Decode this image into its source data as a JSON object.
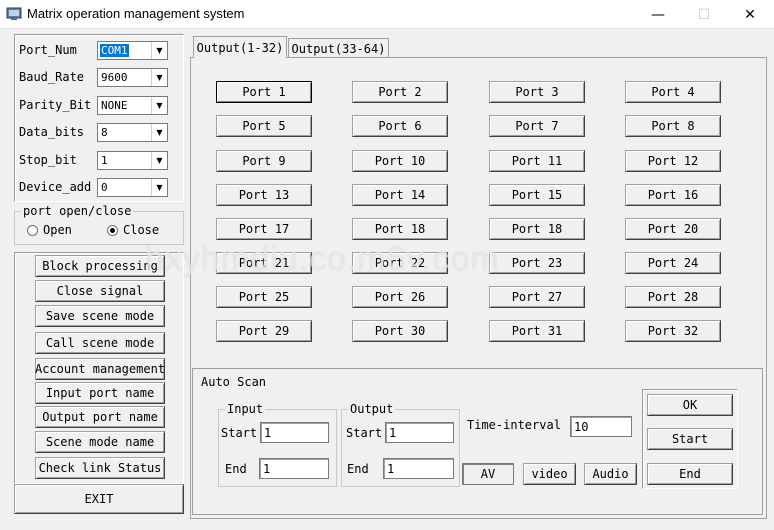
{
  "window": {
    "title": "Matrix operation management system",
    "minimize_glyph": "—",
    "maximize_glyph": "☐",
    "close_glyph": "✕"
  },
  "settings": [
    {
      "label": "Port_Num",
      "value": "COM1",
      "selected": true
    },
    {
      "label": "Baud_Rate",
      "value": "9600"
    },
    {
      "label": "Parity_Bit",
      "value": "NONE"
    },
    {
      "label": "Data_bits",
      "value": "8"
    },
    {
      "label": "Stop_bit",
      "value": "1"
    },
    {
      "label": "Device_add",
      "value": "0"
    }
  ],
  "port_toggle": {
    "title": "port open/close",
    "open_label": "Open",
    "close_label": "Close",
    "selected": "Close"
  },
  "actions": {
    "block_processing": "Block processing",
    "close_signal": "Close signal",
    "save_scene_mode": "Save scene mode",
    "call_scene_mode": "Call scene mode",
    "account_management": "Account management",
    "input_port_name": "Input port name",
    "output_port_name": "Output port name",
    "scene_mode_name": "Scene mode name",
    "check_link_status": "Check link Status",
    "exit": "EXIT"
  },
  "tabs": {
    "output_1_32": "Output(1-32)",
    "output_33_64": "Output(33-64)"
  },
  "ports": [
    "Port 1",
    "Port 2",
    "Port 3",
    "Port 4",
    "Port 5",
    "Port 6",
    "Port 7",
    "Port 8",
    "Port 9",
    "Port 10",
    "Port 11",
    "Port 12",
    "Port 13",
    "Port 14",
    "Port 15",
    "Port 16",
    "Port 17",
    "Port 18",
    "Port 18",
    "Port 20",
    "Port 21",
    "Port 22",
    "Port 23",
    "Port 24",
    "Port 25",
    "Port 26",
    "Port 27",
    "Port 28",
    "Port 29",
    "Port 30",
    "Port 31",
    "Port 32"
  ],
  "auto_scan": {
    "title": "Auto Scan",
    "input_title": "Input",
    "output_title": "Output",
    "start_label": "Start",
    "end_label": "End",
    "input_start": "1",
    "input_end": "1",
    "output_start": "1",
    "output_end": "1",
    "time_interval_label": "Time-interval",
    "time_interval_value": "10",
    "av_label": "AV",
    "video_label": "video",
    "audio_label": "Audio",
    "ok_label": "OK",
    "start_button": "Start",
    "end_button": "End"
  },
  "watermark": "hxyhmdiu.co.m6v.com"
}
